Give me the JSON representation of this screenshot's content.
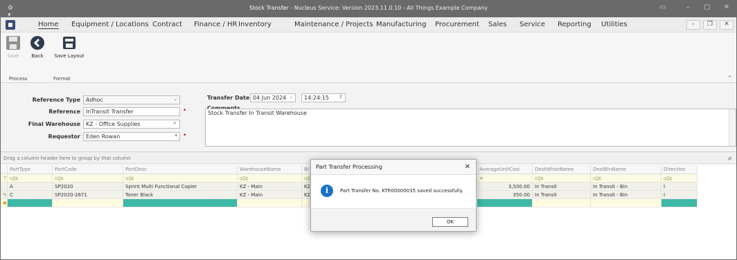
{
  "window": {
    "title_app": "Stock Transfer",
    "title_rest": " - Nucleus Service: Version 2023.11.0.10 - All Things Example Company",
    "app_icon": "gear-icon"
  },
  "menu": {
    "items": [
      "Home",
      "Equipment / Locations",
      "Contract",
      "Finance / HR",
      "Inventory",
      "Maintenance / Projects",
      "Manufacturing",
      "Procurement",
      "Sales",
      "Service",
      "Reporting",
      "Utilities"
    ],
    "minimize": "–",
    "restore": "❐",
    "close": "✕"
  },
  "ribbon": {
    "save_label": "Save",
    "back_label": "Back",
    "save_layout_label": "Save Layout",
    "group_process": "Process",
    "group_format": "Format"
  },
  "form": {
    "reference_type_label": "Reference Type",
    "reference_type_value": "Adhoc",
    "reference_label": "Reference",
    "reference_value": "InTransit Transfer",
    "final_warehouse_label": "Final Warehouse",
    "final_warehouse_value": "KZ - Office Supplies",
    "requestor_label": "Requestor",
    "requestor_value": "Eden Rowan",
    "transfer_date_label": "Transfer Date",
    "transfer_date_value": "04 Jun 2024",
    "transfer_time_value": "14:24:15",
    "comments_label": "Comments",
    "comments_value": "Stock Transfer In Transit Warehouse"
  },
  "grid": {
    "group_hint": "Drag a column header here to group by that column",
    "columns": [
      "PartType",
      "PartCode",
      "PartDesc",
      "WarehouseName",
      "Bi",
      "AverageUnitCost",
      "DestWhseName",
      "DestBinName",
      "Direction"
    ],
    "filter_glyph": "▫▯c",
    "rows": [
      {
        "PartType": "A",
        "PartCode": "SP2020",
        "PartDesc": "Sprint Multi Functional Copier",
        "WarehouseName": "KZ - Main",
        "Bi": "KZ",
        "AverageUnitCost": "3,500.00",
        "DestWhseName": "In Transit",
        "DestBinName": "In Transit - Bin",
        "Direction": "I"
      },
      {
        "PartType": "C",
        "PartCode": "SP2020-2671",
        "PartDesc": "Toner Black",
        "WarehouseName": "KZ - Main",
        "Bi": "KZ",
        "AverageUnitCost": "350.00",
        "DestWhseName": "In Transit",
        "DestBinName": "In Transit - Bin",
        "Direction": "I"
      }
    ],
    "avg_filter": "="
  },
  "dialog": {
    "title": "Part Transfer Processing",
    "message": "Part Transfer No. KTR00000035 saved successfully.",
    "ok_label": "OK",
    "icon": "info-icon"
  },
  "colors": {
    "titlebar": "#6a6a6a",
    "accent_teal": "#3fb8a6",
    "info_blue": "#1a73c8"
  }
}
